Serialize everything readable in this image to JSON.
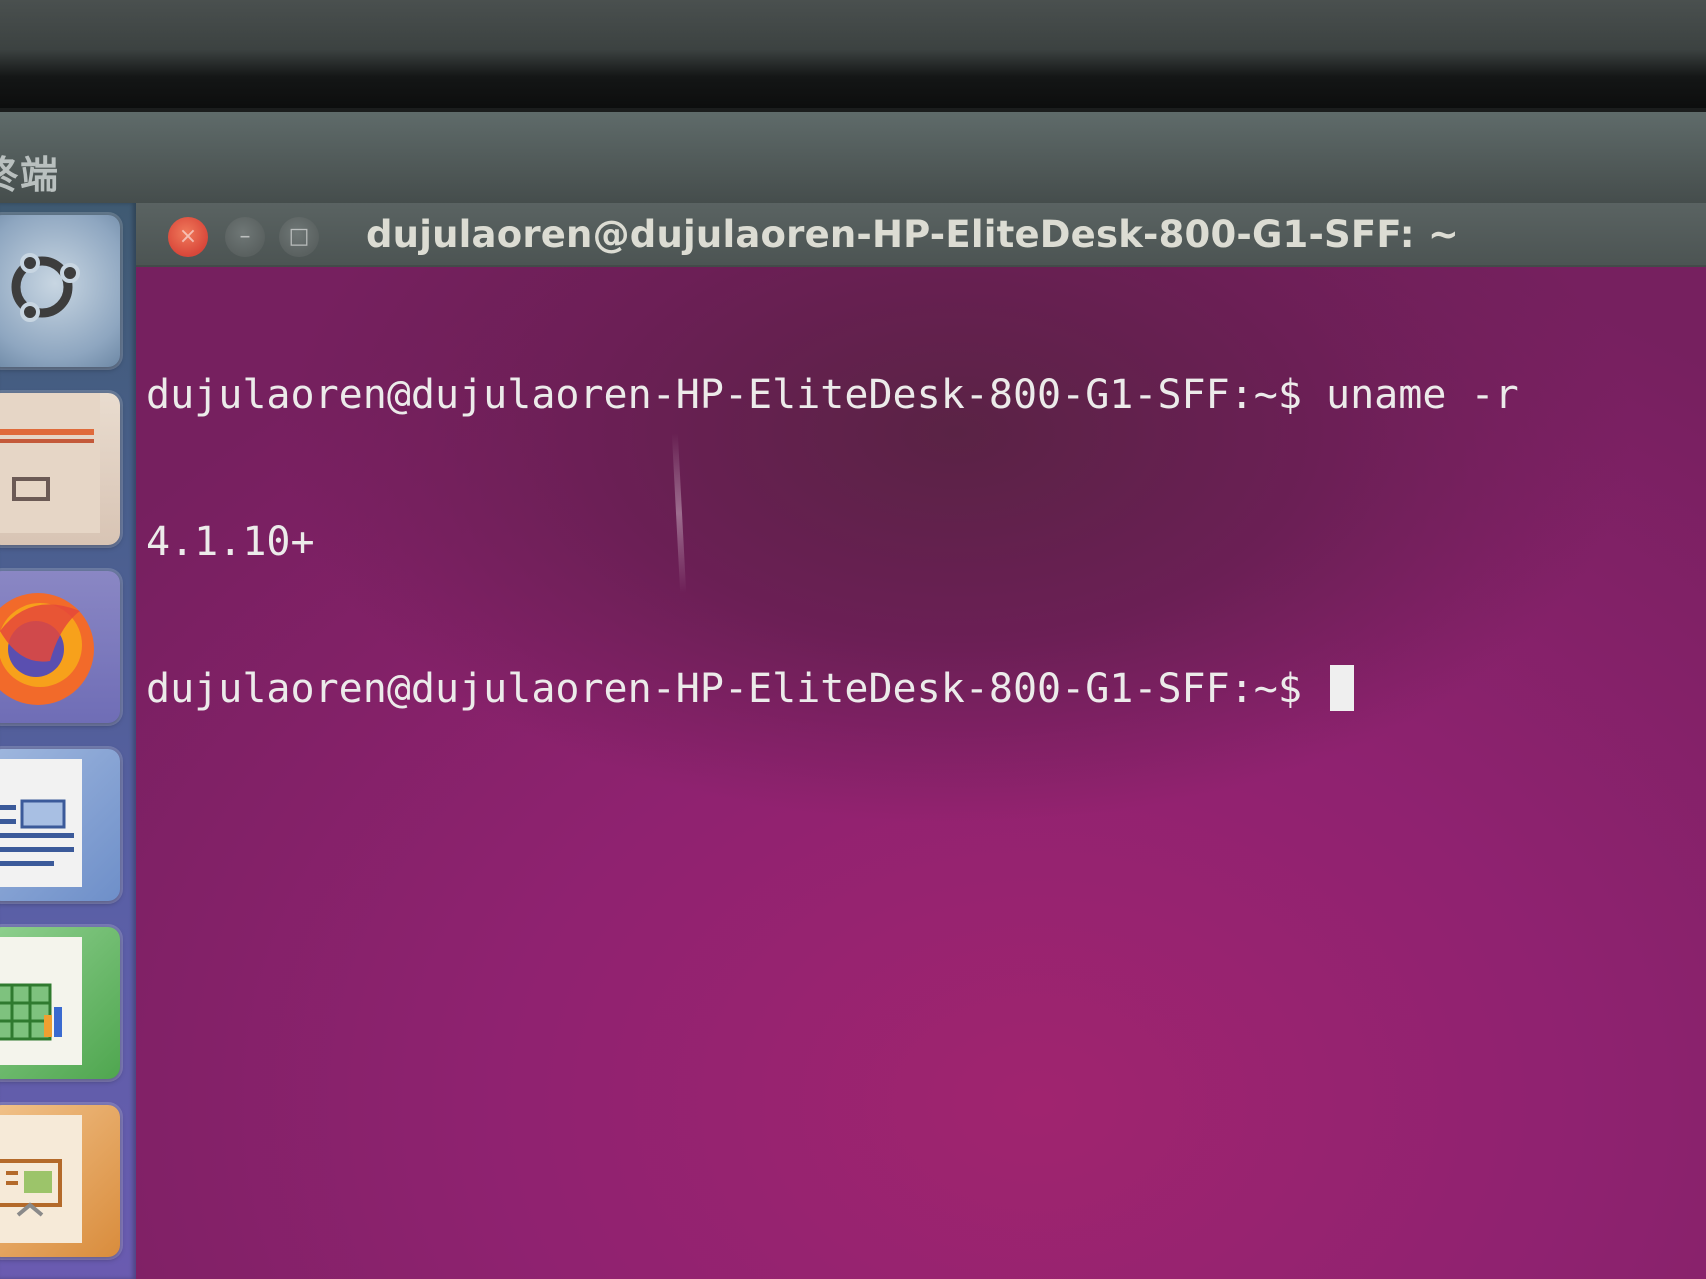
{
  "top_panel": {
    "title": "终端"
  },
  "launcher": {
    "items": [
      {
        "name": "Ubuntu Dash",
        "icon": "ubuntu-logo-icon"
      },
      {
        "name": "Files",
        "icon": "file-manager-icon"
      },
      {
        "name": "Firefox",
        "icon": "firefox-icon"
      },
      {
        "name": "LibreOffice Writer",
        "icon": "writer-icon"
      },
      {
        "name": "LibreOffice Calc",
        "icon": "calc-icon"
      },
      {
        "name": "LibreOffice Impress",
        "icon": "impress-icon"
      }
    ]
  },
  "terminal": {
    "window_title": "dujulaoren@dujulaoren-HP-EliteDesk-800-G1-SFF: ~",
    "buttons": {
      "close": "×",
      "minimize": "–",
      "maximize": "□"
    },
    "lines": [
      "dujulaoren@dujulaoren-HP-EliteDesk-800-G1-SFF:~$ uname -r",
      "4.1.10+",
      "dujulaoren@dujulaoren-HP-EliteDesk-800-G1-SFF:~$ "
    ]
  },
  "colors": {
    "terminal_bg": "#8f2270",
    "close_button": "#e0533f",
    "text": "#ecebea"
  }
}
